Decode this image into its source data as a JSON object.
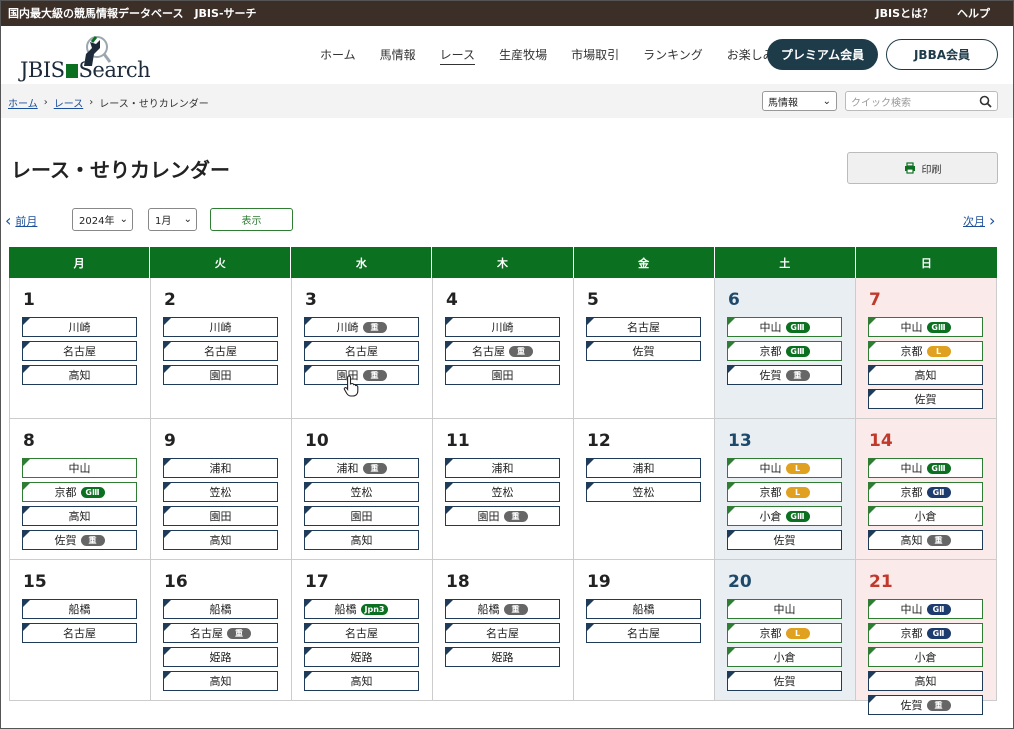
{
  "topbar": {
    "left": "国内最大級の競馬情報データベース　JBIS-サーチ",
    "about": "JBISとは？",
    "help": "ヘルプ"
  },
  "header": {
    "logo": "JBIS Search",
    "nav": [
      "ホーム",
      "馬情報",
      "レース",
      "生産牧場",
      "市場取引",
      "ランキング",
      "お楽しみ"
    ],
    "active_nav": "レース",
    "premium_label": "プレミアム会員",
    "jbba_label": "JBBA会員"
  },
  "breadcrumb": {
    "home": "ホーム",
    "race": "レース",
    "current": "レース・せりカレンダー"
  },
  "search": {
    "category": "馬情報",
    "placeholder": "クイック検索"
  },
  "page": {
    "title": "レース・せりカレンダー",
    "print_label": "印刷"
  },
  "controls": {
    "prev": "前月",
    "next": "次月",
    "year": "2024年",
    "month": "1月",
    "show": "表示"
  },
  "calendar": {
    "weekdays": [
      "月",
      "火",
      "水",
      "木",
      "金",
      "土",
      "日"
    ],
    "weeks": [
      [
        {
          "day": "1",
          "venues": [
            {
              "name": "川崎"
            },
            {
              "name": "名古屋"
            },
            {
              "name": "高知"
            }
          ]
        },
        {
          "day": "2",
          "venues": [
            {
              "name": "川崎"
            },
            {
              "name": "名古屋"
            },
            {
              "name": "園田"
            }
          ]
        },
        {
          "day": "3",
          "venues": [
            {
              "name": "川崎",
              "badge": "重",
              "badge_type": "sho"
            },
            {
              "name": "名古屋"
            },
            {
              "name": "園田",
              "badge": "重",
              "badge_type": "sho"
            }
          ]
        },
        {
          "day": "4",
          "venues": [
            {
              "name": "川崎"
            },
            {
              "name": "名古屋",
              "badge": "重",
              "badge_type": "sho"
            },
            {
              "name": "園田"
            }
          ]
        },
        {
          "day": "5",
          "venues": [
            {
              "name": "名古屋"
            },
            {
              "name": "佐賀"
            }
          ]
        },
        {
          "day": "6",
          "venues": [
            {
              "name": "中山",
              "badge": "GⅢ",
              "badge_type": "g3",
              "central": true
            },
            {
              "name": "京都",
              "badge": "GⅢ",
              "badge_type": "g3",
              "central": true
            },
            {
              "name": "佐賀",
              "badge": "重",
              "badge_type": "sho"
            }
          ]
        },
        {
          "day": "7",
          "venues": [
            {
              "name": "中山",
              "badge": "GⅢ",
              "badge_type": "g3",
              "central": true
            },
            {
              "name": "京都",
              "badge": "L",
              "badge_type": "l",
              "central": true
            },
            {
              "name": "高知"
            },
            {
              "name": "佐賀"
            }
          ]
        }
      ],
      [
        {
          "day": "8",
          "venues": [
            {
              "name": "中山",
              "central": true
            },
            {
              "name": "京都",
              "badge": "GⅢ",
              "badge_type": "g3",
              "central": true
            },
            {
              "name": "高知"
            },
            {
              "name": "佐賀",
              "badge": "重",
              "badge_type": "sho"
            }
          ]
        },
        {
          "day": "9",
          "venues": [
            {
              "name": "浦和"
            },
            {
              "name": "笠松"
            },
            {
              "name": "園田"
            },
            {
              "name": "高知"
            }
          ]
        },
        {
          "day": "10",
          "venues": [
            {
              "name": "浦和",
              "badge": "重",
              "badge_type": "sho"
            },
            {
              "name": "笠松"
            },
            {
              "name": "園田"
            },
            {
              "name": "高知"
            }
          ]
        },
        {
          "day": "11",
          "venues": [
            {
              "name": "浦和"
            },
            {
              "name": "笠松"
            },
            {
              "name": "園田",
              "badge": "重",
              "badge_type": "sho"
            }
          ]
        },
        {
          "day": "12",
          "venues": [
            {
              "name": "浦和"
            },
            {
              "name": "笠松"
            }
          ]
        },
        {
          "day": "13",
          "venues": [
            {
              "name": "中山",
              "badge": "L",
              "badge_type": "l",
              "central": true
            },
            {
              "name": "京都",
              "badge": "L",
              "badge_type": "l",
              "central": true
            },
            {
              "name": "小倉",
              "badge": "GⅢ",
              "badge_type": "g3",
              "central": true
            },
            {
              "name": "佐賀"
            }
          ]
        },
        {
          "day": "14",
          "venues": [
            {
              "name": "中山",
              "badge": "GⅢ",
              "badge_type": "g3",
              "central": true
            },
            {
              "name": "京都",
              "badge": "GⅡ",
              "badge_type": "g2",
              "central": true
            },
            {
              "name": "小倉",
              "central": true
            },
            {
              "name": "高知",
              "badge": "重",
              "badge_type": "sho"
            }
          ]
        }
      ],
      [
        {
          "day": "15",
          "venues": [
            {
              "name": "船橋"
            },
            {
              "name": "名古屋"
            }
          ]
        },
        {
          "day": "16",
          "venues": [
            {
              "name": "船橋"
            },
            {
              "name": "名古屋",
              "badge": "重",
              "badge_type": "sho"
            },
            {
              "name": "姫路"
            },
            {
              "name": "高知"
            }
          ]
        },
        {
          "day": "17",
          "venues": [
            {
              "name": "船橋",
              "badge": "Jpn3",
              "badge_type": "jpn"
            },
            {
              "name": "名古屋"
            },
            {
              "name": "姫路"
            },
            {
              "name": "高知"
            }
          ]
        },
        {
          "day": "18",
          "venues": [
            {
              "name": "船橋",
              "badge": "重",
              "badge_type": "sho"
            },
            {
              "name": "名古屋"
            },
            {
              "name": "姫路"
            }
          ]
        },
        {
          "day": "19",
          "venues": [
            {
              "name": "船橋"
            },
            {
              "name": "名古屋"
            }
          ]
        },
        {
          "day": "20",
          "venues": [
            {
              "name": "中山",
              "central": true
            },
            {
              "name": "京都",
              "badge": "L",
              "badge_type": "l",
              "central": true
            },
            {
              "name": "小倉",
              "central": true
            },
            {
              "name": "佐賀"
            }
          ]
        },
        {
          "day": "21",
          "venues": [
            {
              "name": "中山",
              "badge": "GⅡ",
              "badge_type": "g2",
              "central": true
            },
            {
              "name": "京都",
              "badge": "GⅡ",
              "badge_type": "g2",
              "central": true
            },
            {
              "name": "小倉",
              "central": true
            },
            {
              "name": "高知"
            },
            {
              "name": "佐賀",
              "badge": "重",
              "badge_type": "sho"
            }
          ]
        }
      ]
    ]
  },
  "colors": {
    "topbar": "#3b2f28",
    "header_green": "#0c7021",
    "navy": "#1e3b4a",
    "saturday_bg": "#e9eef3",
    "sunday_bg": "#fbeaea"
  },
  "icons": {
    "print": "printer-icon",
    "search": "magnifier-icon",
    "cursor": "hand-pointer-icon"
  }
}
